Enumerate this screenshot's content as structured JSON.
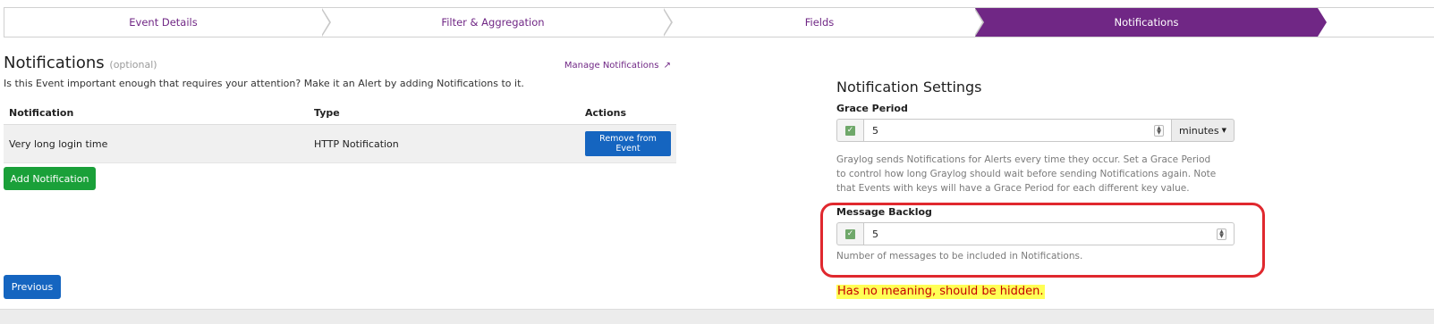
{
  "wizard": {
    "steps": [
      {
        "label": "Event Details"
      },
      {
        "label": "Filter & Aggregation"
      },
      {
        "label": "Fields"
      },
      {
        "label": "Notifications"
      }
    ]
  },
  "notifications_panel": {
    "title": "Notifications",
    "optional": "(optional)",
    "manage_link": "Manage Notifications",
    "description": "Is this Event important enough that requires your attention? Make it an Alert by adding Notifications to it.",
    "table": {
      "headers": [
        "Notification",
        "Type",
        "Actions"
      ],
      "rows": [
        {
          "notification": "Very long login time",
          "type": "HTTP Notification",
          "action": "Remove from Event"
        }
      ]
    },
    "add_button": "Add Notification",
    "previous_button": "Previous"
  },
  "settings": {
    "title": "Notification Settings",
    "grace_period": {
      "label": "Grace Period",
      "value": "5",
      "unit": "minutes",
      "help": "Graylog sends Notifications for Alerts every time they occur. Set a Grace Period to control how long Graylog should wait before sending Notifications again. Note that Events with keys will have a Grace Period for each different key value."
    },
    "message_backlog": {
      "label": "Message Backlog",
      "value": "5",
      "help": "Number of messages to be included in Notifications."
    }
  },
  "annotation": {
    "note": "Has no meaning, should be hidden.",
    "color": "#e0282e"
  },
  "colors": {
    "brand": "#702785",
    "primary": "#1565c0",
    "success": "#1aa039"
  }
}
